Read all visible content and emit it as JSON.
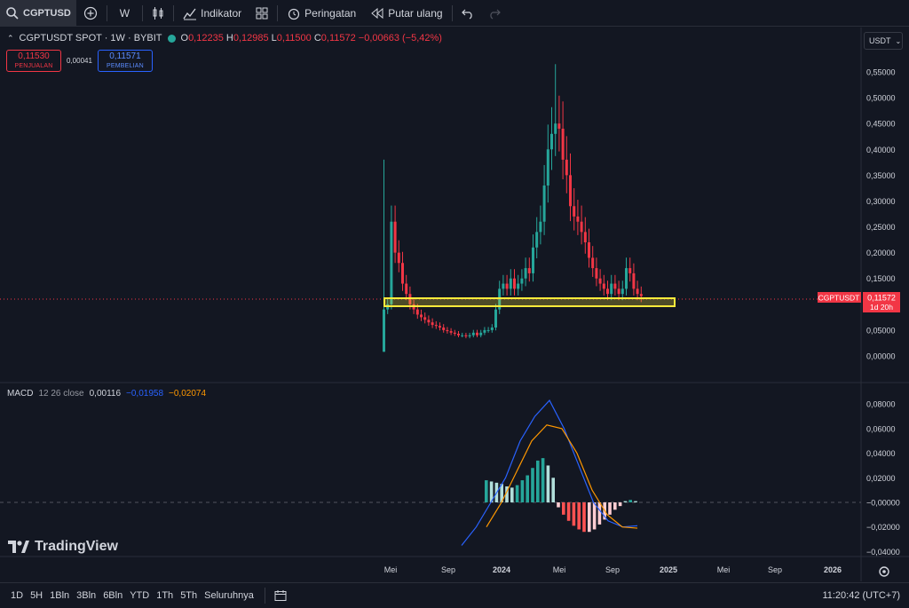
{
  "toolbar": {
    "symbol": "CGPTUSD",
    "interval": "W",
    "indicators_label": "Indikator",
    "alerts_label": "Peringatan",
    "replay_label": "Putar ulang"
  },
  "legend": {
    "title": "CGPTUSDT SPOT · 1W · BYBIT",
    "open_label": "O",
    "open_value": "0,12235",
    "high_label": "H",
    "high_value": "0,12985",
    "low_label": "L",
    "low_value": "0,11500",
    "close_label": "C",
    "close_value": "0,11572",
    "change": "−0,00663 (−5,42%)"
  },
  "trade": {
    "sell_price": "0,11530",
    "sell_label": "PENJUALAN",
    "spread": "0,00041",
    "buy_price": "0,11571",
    "buy_label": "PEMBELIAN"
  },
  "currency": "USDT",
  "price_axis": [
    "0,55000",
    "0,50000",
    "0,45000",
    "0,40000",
    "0,35000",
    "0,30000",
    "0,25000",
    "0,20000",
    "0,15000",
    "0,10000",
    "0,05000",
    "0,00000"
  ],
  "price_tag": {
    "symbol": "CGPTUSDT",
    "price": "0,11572",
    "countdown": "1d 20h"
  },
  "macd": {
    "name": "MACD",
    "params": "12 26 close",
    "hist": "0,00116",
    "macd": "−0,01958",
    "signal": "−0,02074"
  },
  "macd_axis": [
    "0,08000",
    "0,06000",
    "0,04000",
    "0,02000",
    "−0,00000",
    "−0,02000",
    "−0,04000"
  ],
  "time_axis": [
    "Mei",
    "Sep",
    "2024",
    "Mei",
    "Sep",
    "2025",
    "Mei",
    "Sep",
    "2026"
  ],
  "logo_text": "TradingView",
  "ranges": [
    "1D",
    "5H",
    "1Bln",
    "3Bln",
    "6Bln",
    "YTD",
    "1Th",
    "5Th",
    "Seluruhnya"
  ],
  "clock": "11:20:42 (UTC+7)",
  "colors": {
    "up": "#26a69a",
    "down": "#f23645",
    "macd": "#2962ff",
    "signal": "#ff9800",
    "zone": "#ffeb3b"
  },
  "chart_data": {
    "type": "candlestick",
    "symbol": "CGPTUSDT",
    "timeframe": "1W",
    "ylim": [
      0,
      0.57
    ],
    "weekly_closes_approx": [
      0.09,
      0.1,
      0.26,
      0.2,
      0.18,
      0.14,
      0.12,
      0.1,
      0.09,
      0.08,
      0.075,
      0.07,
      0.065,
      0.06,
      0.058,
      0.055,
      0.05,
      0.048,
      0.045,
      0.043,
      0.04,
      0.04,
      0.038,
      0.04,
      0.045,
      0.04,
      0.045,
      0.05,
      0.05,
      0.055,
      0.09,
      0.13,
      0.14,
      0.13,
      0.15,
      0.13,
      0.14,
      0.15,
      0.17,
      0.16,
      0.21,
      0.24,
      0.26,
      0.33,
      0.4,
      0.43,
      0.45,
      0.44,
      0.38,
      0.35,
      0.29,
      0.27,
      0.26,
      0.24,
      0.22,
      0.19,
      0.17,
      0.15,
      0.14,
      0.13,
      0.12,
      0.14,
      0.13,
      0.12,
      0.13,
      0.17,
      0.16,
      0.13,
      0.12,
      0.11572
    ],
    "support_zone": [
      0.095,
      0.11
    ],
    "macd_series": {
      "histogram_approx": [
        0.018,
        0.017,
        0.016,
        0.015,
        0.013,
        0.012,
        0.014,
        0.018,
        0.022,
        0.028,
        0.034,
        0.036,
        0.03,
        0.02,
        -0.004,
        -0.01,
        -0.015,
        -0.019,
        -0.022,
        -0.024,
        -0.024,
        -0.022,
        -0.018,
        -0.014,
        -0.01,
        -0.006,
        -0.003,
        0.001,
        0.002,
        0.001
      ],
      "macd_approx": [
        -0.035,
        -0.02,
        0.0,
        0.02,
        0.05,
        0.07,
        0.083,
        0.06,
        0.03,
        0.0,
        -0.015,
        -0.02,
        -0.019
      ],
      "signal_approx": [
        -0.02,
        0.0,
        0.025,
        0.05,
        0.063,
        0.06,
        0.04,
        0.01,
        -0.01,
        -0.02,
        -0.021
      ]
    }
  }
}
